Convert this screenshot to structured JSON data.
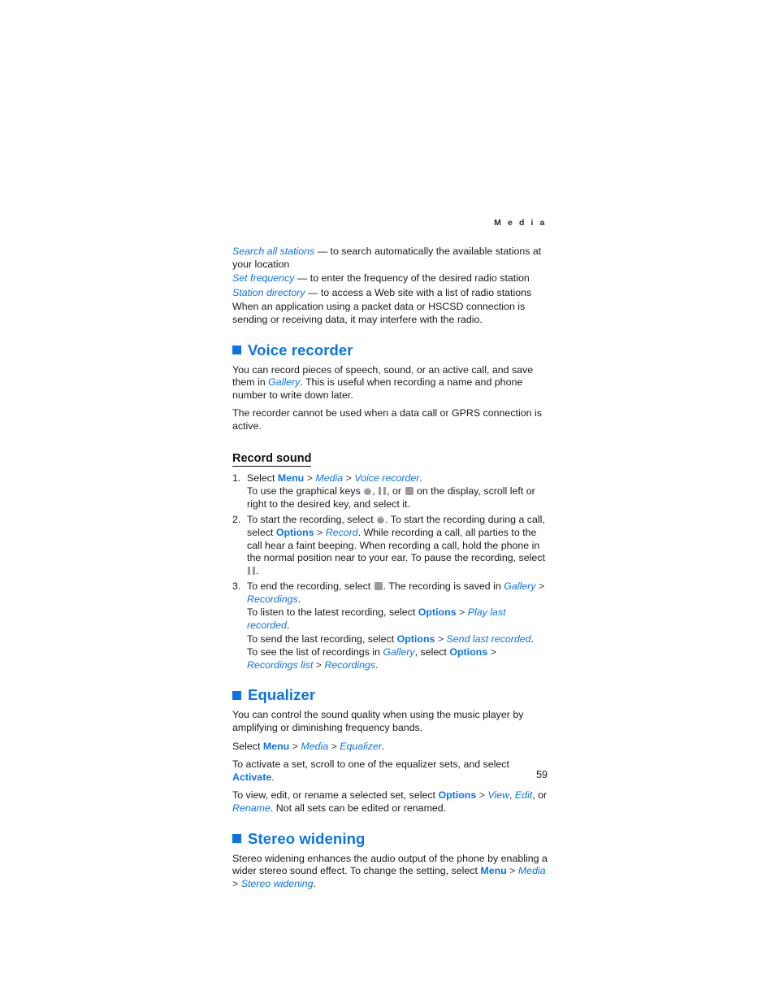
{
  "header": {
    "running_head": "M e d i a"
  },
  "colors": {
    "link_blue": "#0b74e5",
    "body_text": "#1a1a1a",
    "icon_gray": "#9a9a9a"
  },
  "radio_options": {
    "items": [
      {
        "term": "Search all stations",
        "dash": "—",
        "definition": "to search automatically the available stations at your location"
      },
      {
        "term": "Set frequency",
        "dash": "—",
        "definition": "to enter the frequency of the desired radio station"
      },
      {
        "term": "Station directory",
        "dash": "—",
        "definition": "to access a Web site with a list of radio stations"
      }
    ],
    "note": "When an application using a packet data or HSCSD connection is sending or receiving data, it may interfere with the radio."
  },
  "voice_recorder": {
    "heading": "Voice recorder",
    "intro": "You can record pieces of speech, sound, or an active call, and save them in ",
    "intro_link": "Gallery",
    "intro_tail": ". This is useful when recording a name and phone number to write down later.",
    "restriction": "The recorder cannot be used when a data call or GPRS connection is active.",
    "record_sound_heading": "Record sound",
    "steps": [
      {
        "num": "1.",
        "select_label": "Select ",
        "path_menu": "Menu",
        "path_media": "Media",
        "path_target": "Voice recorder",
        "sub_a": "To use the graphical keys ",
        "sub_b": ", ",
        "sub_c": ", or ",
        "sub_d": " on the display, scroll left or right to the desired key, and select it."
      },
      {
        "num": "2.",
        "line_a": "To start the recording, select ",
        "line_b": ". To start the recording during a call, select ",
        "options_label": "Options",
        "record_label": "Record",
        "line_c": ". While recording a call, all parties to the call hear a faint beeping. When recording a call, hold the phone in the normal position near to your ear. To pause the recording, select ",
        "line_d": "."
      },
      {
        "num": "3.",
        "line_a": "To end the recording, select ",
        "line_b": ". The recording is saved in ",
        "gallery_label": "Gallery",
        "recordings_label": "Recordings",
        "line_c": ".",
        "listen_a": "To listen to the latest recording, select ",
        "listen_options": "Options",
        "listen_target": "Play last recorded",
        "listen_tail": ".",
        "send_a": "To send the last recording, select ",
        "send_options": "Options",
        "send_target": "Send last recorded",
        "send_tail": ".",
        "list_a": "To see the list of recordings in ",
        "list_gallery": "Gallery",
        "list_b": ", select ",
        "list_options": "Options",
        "list_target": "Recordings list",
        "list_recordings": "Recordings",
        "list_tail": "."
      }
    ]
  },
  "equalizer": {
    "heading": "Equalizer",
    "intro": "You can control the sound quality when using the music player by amplifying or diminishing frequency bands.",
    "select_label": "Select ",
    "path_menu": "Menu",
    "path_media": "Media",
    "path_target": "Equalizer",
    "activate_a": "To activate a set, scroll to one of the equalizer sets, and select ",
    "activate_label": "Activate",
    "activate_tail": ".",
    "view_a": "To view, edit, or rename a selected set, select ",
    "view_options": "Options",
    "view_label": "View",
    "edit_label": "Edit",
    "or_label": ", or ",
    "rename_label": "Rename",
    "view_tail": ". Not all sets can be edited or renamed."
  },
  "stereo_widening": {
    "heading": "Stereo widening",
    "body_a": "Stereo widening enhances the audio output of the phone by enabling a wider stereo sound effect. To change the setting, select ",
    "path_menu": "Menu",
    "path_media": "Media",
    "path_target": "Stereo widening",
    "body_tail": "."
  },
  "folio": {
    "page_number": "59"
  }
}
